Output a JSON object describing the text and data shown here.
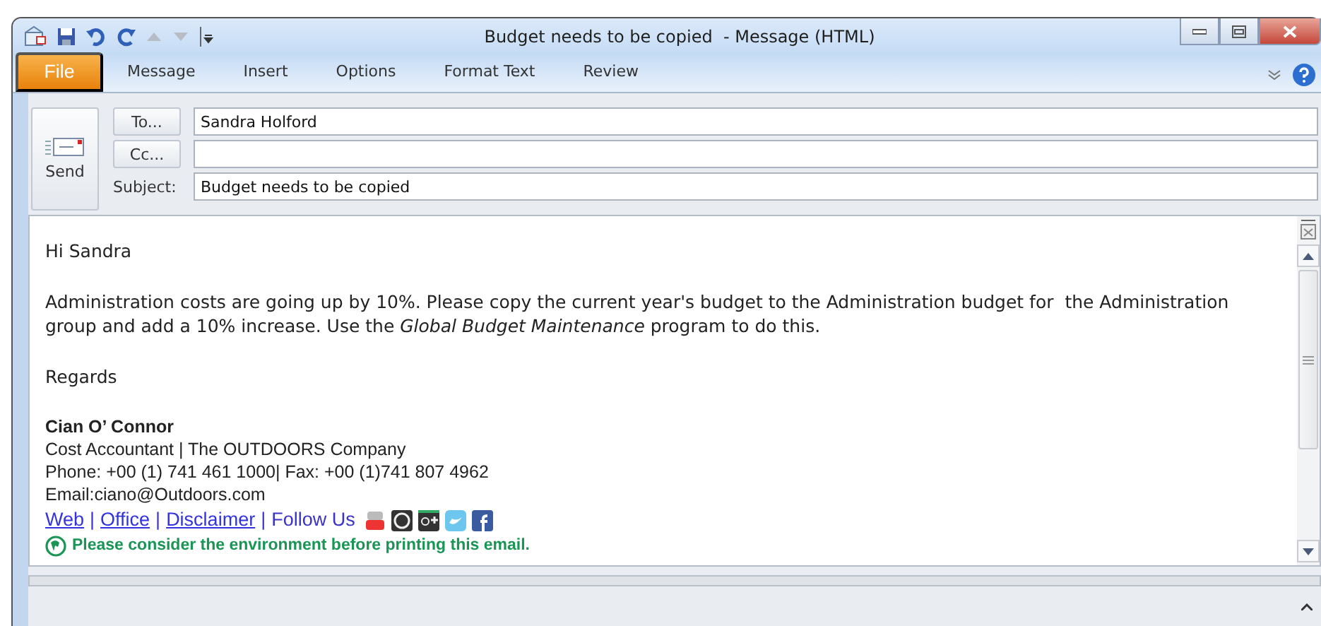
{
  "window": {
    "title": "Budget needs to be copied  - Message (HTML)"
  },
  "ribbon_tabs": [
    {
      "label": "File",
      "kind": "file"
    },
    {
      "label": "Message",
      "kind": "tab"
    },
    {
      "label": "Insert",
      "kind": "tab"
    },
    {
      "label": "Options",
      "kind": "tab"
    },
    {
      "label": "Format Text",
      "kind": "tab"
    },
    {
      "label": "Review",
      "kind": "tab"
    }
  ],
  "header": {
    "send_label": "Send",
    "fields": [
      {
        "label": "To...",
        "kind": "button",
        "value": "Sandra Holford"
      },
      {
        "label": "Cc...",
        "kind": "button"
      },
      {
        "label": "Subject:",
        "kind": "label",
        "value": "Budget needs to be copied"
      }
    ]
  },
  "body": {
    "greeting": "Hi Sandra",
    "paragraph": "Administration costs are going up by 10%. Please copy the current year's budget to the Administration budget for  the Administration group and add a 10% increase. Use the *Global Budget Maintenance* program to do this.",
    "closing": "Regards",
    "signature": {
      "name": "Cian O’ Connor",
      "lines": [
        "Cost Accountant | The OUTDOORS Company",
        "Phone: +00 (1) 741 461 1000| Fax: +00 (1)741 807 4962",
        "Email:ciano@Outdoors.com"
      ],
      "links_row": [
        {
          "kind": "link",
          "text": "Web"
        },
        {
          "kind": "sep",
          "text": "|"
        },
        {
          "kind": "link",
          "text": "Office"
        },
        {
          "kind": "sep",
          "text": "|"
        },
        {
          "kind": "link",
          "text": "Disclaimer"
        },
        {
          "kind": "sep",
          "text": "|"
        },
        {
          "kind": "text",
          "text": "Follow Us"
        }
      ],
      "notice": "Please consider the environment before printing this email."
    }
  }
}
